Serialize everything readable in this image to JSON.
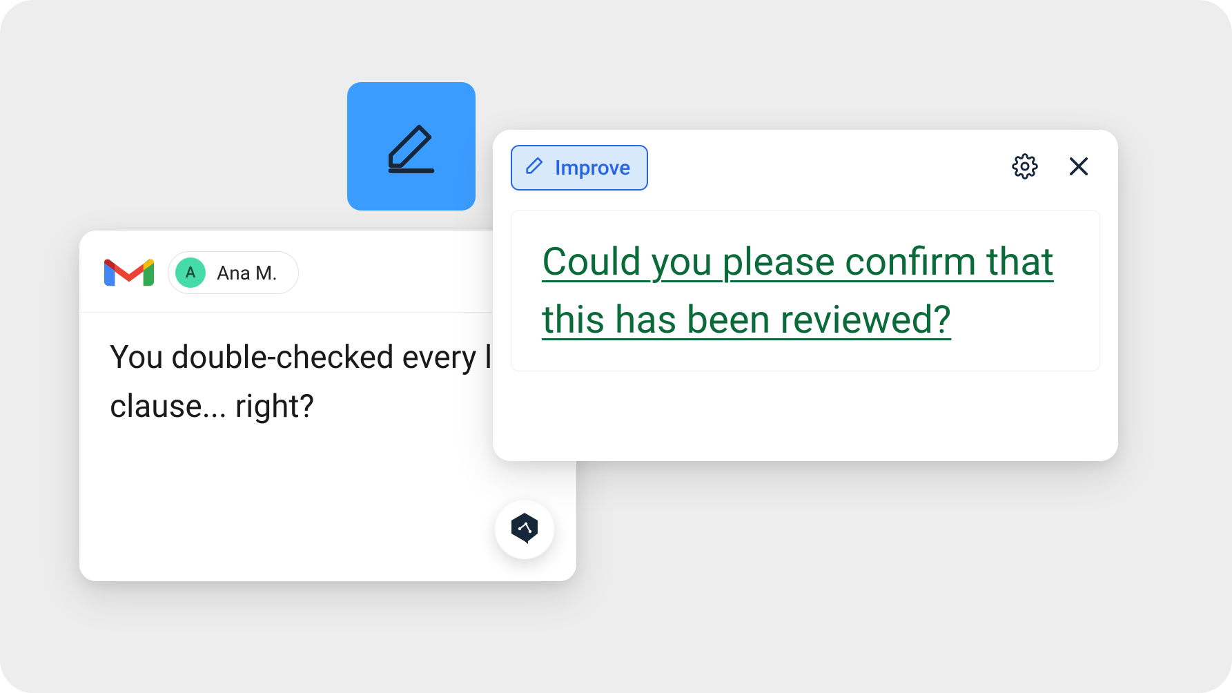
{
  "icons": {
    "edit_tile": "pencil-edit-icon"
  },
  "email": {
    "sender_initial": "A",
    "sender_name": "Ana M.",
    "body": "You double-checked every last clause... right?"
  },
  "suggestion": {
    "chip_label": "Improve",
    "text": "Could you please confirm that this has been reviewed?"
  }
}
